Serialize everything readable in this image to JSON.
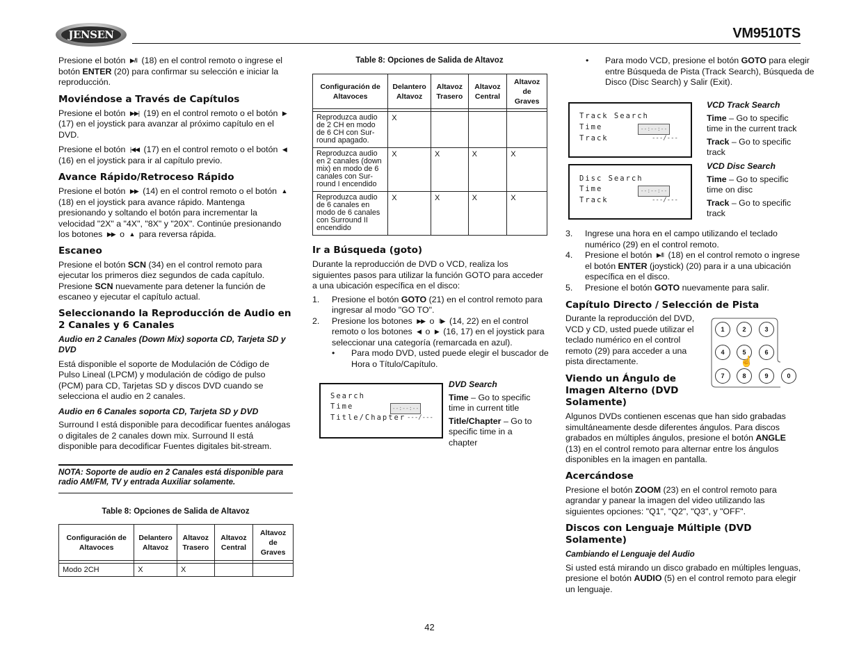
{
  "header": {
    "logo": "JENSEN",
    "model": "VM9510TS"
  },
  "left": {
    "intro": {
      "pre": "Presione el botón",
      "icon": "play-pause",
      "post1": "(18) en el control remoto o ingrese el botón",
      "bold": "ENTER",
      "post2": "(20) para confirmar su selección e iniciar la reproducción."
    },
    "chapters": {
      "heading": "Moviéndose a Través de Capítulos",
      "p1": {
        "a": "Presione el botón",
        "b": "(19) en el control remoto o el botón",
        "c": "(17) en el joystick para avanzar al próximo capítulo en el DVD."
      },
      "p2": {
        "a": "Presione el botón",
        "b": "(17) en el control remoto o el botón",
        "c": "(16) en el joystick para ir al capítulo previo."
      }
    },
    "ff": {
      "heading": "Avance Rápido/Retroceso Rápido",
      "a": "Presione el botón",
      "b": "(14) en el control remoto o el botón",
      "c": "(18) en el joystick para avance rápido.  Mantenga presionando y soltando el botón para incrementar la velocidad \"2X\" a \"4X\", \"8X\" y \"20X\". Continúe presionando",
      "d": "los botones",
      "e": "o",
      "f": "para reversa rápida."
    },
    "scan": {
      "heading": "Escaneo",
      "a": "Presione el botón",
      "b1": "SCN",
      "c": "(34) en el control remoto para ejecutar los primeros diez segundos de cada capítulo. Presione",
      "b2": "SCN",
      "d": "nuevamente para detener la función de escaneo y ejecutar el capítulo actual."
    },
    "audio": {
      "heading": "Seleccionando la Reproducción de Audio en 2 Canales y 6 Canales",
      "sub1": "Audio en 2 Canales (Down Mix) soporta CD, Tarjeta SD y DVD",
      "p1": "Está disponible el soporte de Modulación de Código de Pulso Lineal (LPCM) y modulación de código de pulso (PCM) para CD, Tarjetas SD y discos DVD cuando se selecciona el audio en 2 canales.",
      "sub2": "Audio en 6 Canales soporta CD, Tarjeta SD y DVD",
      "p2": "Surround I está disponible para  decodificar fuentes análogas o digitales de 2 canales down mix. Surround II está disponible para decodificar Fuentes digitales bit-stream."
    },
    "note": "NOTA: Soporte de audio en 2 Canales está disponible para radio AM/FM, TV y entrada Auxiliar solamente.",
    "table": {
      "caption": "Table 8: Opciones de Salida de Altavoz",
      "headers": [
        "Configuración de Altavoces",
        "Delantero Altavoz",
        "Altavoz Trasero",
        "Altavoz Central",
        "Altavoz de Graves"
      ],
      "rows": [
        [
          "Modo 2CH",
          "X",
          "X",
          "",
          ""
        ]
      ]
    }
  },
  "middle": {
    "table": {
      "caption": "Table 8: Opciones de Salida de Altavoz",
      "headers": [
        "Configuración de Altavoces",
        "Delantero Altavoz",
        "Altavoz Trasero",
        "Altavoz Central",
        "Altavoz de Graves"
      ],
      "rows": [
        [
          "Reproduzca audio de 2 CH en modo de 6 CH con Sur-round apagado.",
          "X",
          "",
          "",
          ""
        ],
        [
          "Reproduzca audio en 2 canales (down mix) en modo de 6 canales con Sur-round I encendido",
          "X",
          "X",
          "X",
          "X"
        ],
        [
          "Reproduzca audio de 6 canales en modo de 6 canales con Surround II encendido",
          "X",
          "X",
          "X",
          "X"
        ]
      ]
    },
    "goto": {
      "heading": "Ir a Búsqueda (goto)",
      "intro": "Durante la reproducción de DVD o VCD, realiza los siguientes pasos para utilizar la función GOTO para acceder a una ubicación específica en el disco:",
      "step1": {
        "num": "1.",
        "a": "Presione el botón",
        "b": "GOTO",
        "c": "(21) en el control remoto para ingresar al modo \"GO TO\"."
      },
      "step2": {
        "num": "2.",
        "a": "Presione los botones",
        "b": "o",
        "c": "(14, 22) en el control remoto o los botones",
        "d": "o",
        "e": "(16, 17) en el joystick para seleccionar una categoría (remarcada en azul)."
      },
      "bullet1": "Para modo DVD, usted puede elegir el buscador de Hora o Título/Capítulo."
    },
    "dvd_screen": {
      "line1": "Search",
      "line2": "Time",
      "line3": "Title/Chapter",
      "field": "--:--:--",
      "value": "---/---"
    },
    "dvd_desc": {
      "title": "DVD Search",
      "t1b": "Time",
      "t1": "– Go to specific time in current title",
      "t2b": "Title/Chapter",
      "t2": "– Go to specific time in a chapter"
    }
  },
  "right": {
    "bullet2": {
      "a": "Para modo VCD, presione el botón",
      "b": "GOTO",
      "c": "para elegir entre Búsqueda de Pista (Track Search), Búsqueda de Disco (Disc Search)  y Salir (Exit)."
    },
    "track_screen": {
      "line1": "Track Search",
      "line2": "Time",
      "line3": "Track",
      "field": "--:--:--",
      "value": "---/---"
    },
    "track_desc": {
      "title": "VCD Track Search",
      "t1b": "Time",
      "t1": "– Go to specific time in the current track",
      "t2b": "Track",
      "t2": "– Go to specific track"
    },
    "disc_screen": {
      "line1": "Disc Search",
      "line2": "Time",
      "line3": "Track",
      "field": "--:--:--",
      "value": "---/---"
    },
    "disc_desc": {
      "title": "VCD Disc Search",
      "t1b": "Time",
      "t1": "– Go to specific time on disc",
      "t2b": "Track",
      "t2": "– Go to specific track"
    },
    "step3": {
      "num": "3.",
      "text": "Ingrese una hora en el campo utilizando el teclado numérico (29) en el control remoto."
    },
    "step4": {
      "num": "4.",
      "a": "Presione el botón",
      "b": "(18) en el control remoto o ingrese el botón",
      "c": "ENTER",
      "d": "(joystick) (20) para ir a una ubicación específica en el disco."
    },
    "step5": {
      "num": "5.",
      "a": "Presione el botón",
      "b": "GOTO",
      "c": "nuevamente para salir."
    },
    "direct": {
      "heading": "Capítulo Directo / Selección de Pista",
      "text": "Durante la reproducción del DVD, VCD y CD, usted puede utilizar el teclado numérico en el control remoto (29) para acceder a una pista directamente.",
      "keys": [
        "1",
        "2",
        "3",
        "4",
        "5",
        "6",
        "7",
        "8",
        "9",
        "0"
      ]
    },
    "angle": {
      "heading": "Viendo un Ángulo de Imagen Alterno (DVD Solamente)",
      "a": "Algunos DVDs contienen escenas que han sido grabadas simultáneamente desde diferentes ángulos. Para discos grabados en múltiples ángulos, presione el botón",
      "b": "ANGLE",
      "c": "(13) en el control remoto para alternar entre los ángulos disponibles en la imagen en pantalla."
    },
    "zoom": {
      "heading": "Acercándose",
      "a": "Presione el botón",
      "b": "ZOOM",
      "c": "(23) en el control remoto para agrandar y panear la imagen del video utilizando las siguientes opciones: \"Q1\", \"Q2\", \"Q3\", y \"OFF\"."
    },
    "lang": {
      "heading": "Discos con Lenguaje Múltiple (DVD Solamente)",
      "sub": "Cambiando el Lenguaje del Audio",
      "a": "Si usted está mirando un disco grabado en múltiples lenguas, presione el botón",
      "b": "AUDIO",
      "c": "(5)  en el control remoto para elegir un lenguaje."
    }
  },
  "footer": {
    "page": "42"
  }
}
